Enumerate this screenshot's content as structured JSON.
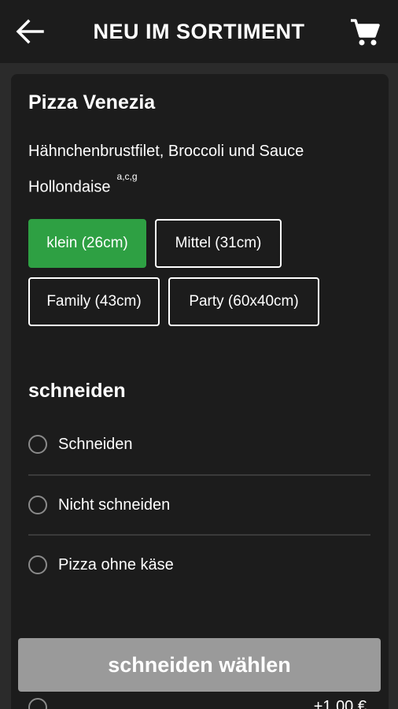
{
  "header": {
    "title": "NEU IM SORTIMENT",
    "back_icon": "arrow-left",
    "cart_icon": "shopping-cart"
  },
  "product": {
    "title": "Pizza Venezia",
    "description": "Hähnchenbrustfilet, Broccoli und Sauce Hollondaise",
    "allergens": "a,c,g"
  },
  "sizes": [
    {
      "label": "klein (26cm)",
      "selected": true
    },
    {
      "label": "Mittel (31cm)",
      "selected": false
    },
    {
      "label": "Family (43cm)",
      "selected": false
    },
    {
      "label": "Party (60x40cm)",
      "selected": false
    }
  ],
  "cut_section": {
    "title": "schneiden",
    "options": [
      {
        "label": "Schneiden"
      },
      {
        "label": "Nicht schneiden"
      },
      {
        "label": "Pizza ohne käse"
      }
    ]
  },
  "choose_button": {
    "label": "schneiden wählen"
  },
  "peek_row": {
    "price": "+1,00 €"
  },
  "colors": {
    "background": "#2b2b2b",
    "card": "#1c1c1c",
    "selected_green": "#2ea043",
    "button_disabled": "#9a9a9a"
  }
}
